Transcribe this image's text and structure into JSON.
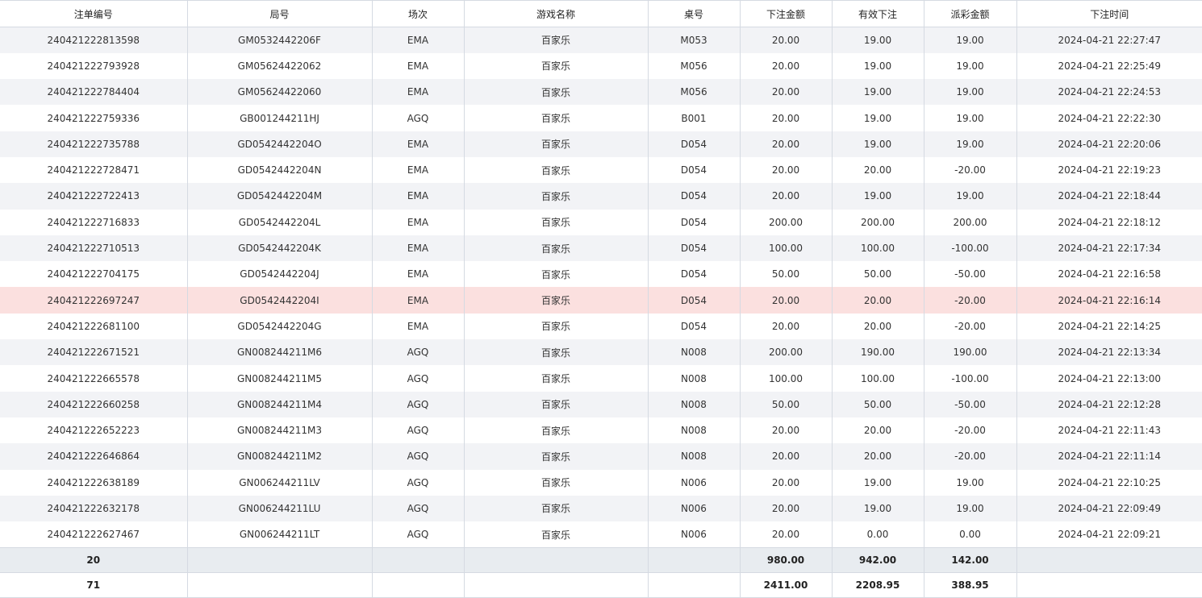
{
  "table": {
    "headers": [
      "注单编号",
      "局号",
      "场次",
      "游戏名称",
      "桌号",
      "下注金额",
      "有效下注",
      "派彩金额",
      "下注时间"
    ],
    "rows": [
      [
        "240421222813598",
        "GM0532442206F",
        "EMA",
        "百家乐",
        "M053",
        "20.00",
        "19.00",
        "19.00",
        "2024-04-21 22:27:47"
      ],
      [
        "240421222793928",
        "GM05624422062",
        "EMA",
        "百家乐",
        "M056",
        "20.00",
        "19.00",
        "19.00",
        "2024-04-21 22:25:49"
      ],
      [
        "240421222784404",
        "GM05624422060",
        "EMA",
        "百家乐",
        "M056",
        "20.00",
        "19.00",
        "19.00",
        "2024-04-21 22:24:53"
      ],
      [
        "240421222759336",
        "GB001244211HJ",
        "AGQ",
        "百家乐",
        "B001",
        "20.00",
        "19.00",
        "19.00",
        "2024-04-21 22:22:30"
      ],
      [
        "240421222735788",
        "GD0542442204O",
        "EMA",
        "百家乐",
        "D054",
        "20.00",
        "19.00",
        "19.00",
        "2024-04-21 22:20:06"
      ],
      [
        "240421222728471",
        "GD0542442204N",
        "EMA",
        "百家乐",
        "D054",
        "20.00",
        "20.00",
        "-20.00",
        "2024-04-21 22:19:23"
      ],
      [
        "240421222722413",
        "GD0542442204M",
        "EMA",
        "百家乐",
        "D054",
        "20.00",
        "19.00",
        "19.00",
        "2024-04-21 22:18:44"
      ],
      [
        "240421222716833",
        "GD0542442204L",
        "EMA",
        "百家乐",
        "D054",
        "200.00",
        "200.00",
        "200.00",
        "2024-04-21 22:18:12"
      ],
      [
        "240421222710513",
        "GD0542442204K",
        "EMA",
        "百家乐",
        "D054",
        "100.00",
        "100.00",
        "-100.00",
        "2024-04-21 22:17:34"
      ],
      [
        "240421222704175",
        "GD0542442204J",
        "EMA",
        "百家乐",
        "D054",
        "50.00",
        "50.00",
        "-50.00",
        "2024-04-21 22:16:58"
      ],
      [
        "240421222697247",
        "GD0542442204I",
        "EMA",
        "百家乐",
        "D054",
        "20.00",
        "20.00",
        "-20.00",
        "2024-04-21 22:16:14"
      ],
      [
        "240421222681100",
        "GD0542442204G",
        "EMA",
        "百家乐",
        "D054",
        "20.00",
        "20.00",
        "-20.00",
        "2024-04-21 22:14:25"
      ],
      [
        "240421222671521",
        "GN008244211M6",
        "AGQ",
        "百家乐",
        "N008",
        "200.00",
        "190.00",
        "190.00",
        "2024-04-21 22:13:34"
      ],
      [
        "240421222665578",
        "GN008244211M5",
        "AGQ",
        "百家乐",
        "N008",
        "100.00",
        "100.00",
        "-100.00",
        "2024-04-21 22:13:00"
      ],
      [
        "240421222660258",
        "GN008244211M4",
        "AGQ",
        "百家乐",
        "N008",
        "50.00",
        "50.00",
        "-50.00",
        "2024-04-21 22:12:28"
      ],
      [
        "240421222652223",
        "GN008244211M3",
        "AGQ",
        "百家乐",
        "N008",
        "20.00",
        "20.00",
        "-20.00",
        "2024-04-21 22:11:43"
      ],
      [
        "240421222646864",
        "GN008244211M2",
        "AGQ",
        "百家乐",
        "N008",
        "20.00",
        "20.00",
        "-20.00",
        "2024-04-21 22:11:14"
      ],
      [
        "240421222638189",
        "GN006244211LV",
        "AGQ",
        "百家乐",
        "N006",
        "20.00",
        "19.00",
        "19.00",
        "2024-04-21 22:10:25"
      ],
      [
        "240421222632178",
        "GN006244211LU",
        "AGQ",
        "百家乐",
        "N006",
        "20.00",
        "19.00",
        "19.00",
        "2024-04-21 22:09:49"
      ],
      [
        "240421222627467",
        "GN006244211LT",
        "AGQ",
        "百家乐",
        "N006",
        "20.00",
        "0.00",
        "0.00",
        "2024-04-21 22:09:21"
      ]
    ],
    "highlighted_row": 10,
    "subtotal": [
      "20",
      "",
      "",
      "",
      "",
      "980.00",
      "942.00",
      "142.00",
      ""
    ],
    "total": [
      "71",
      "",
      "",
      "",
      "",
      "2411.00",
      "2208.95",
      "388.95",
      ""
    ]
  },
  "colors": {
    "stripe": "#f2f3f6",
    "highlight": "#fbe0df",
    "footer": "#e8ecf0",
    "border": "#d5dae2"
  }
}
